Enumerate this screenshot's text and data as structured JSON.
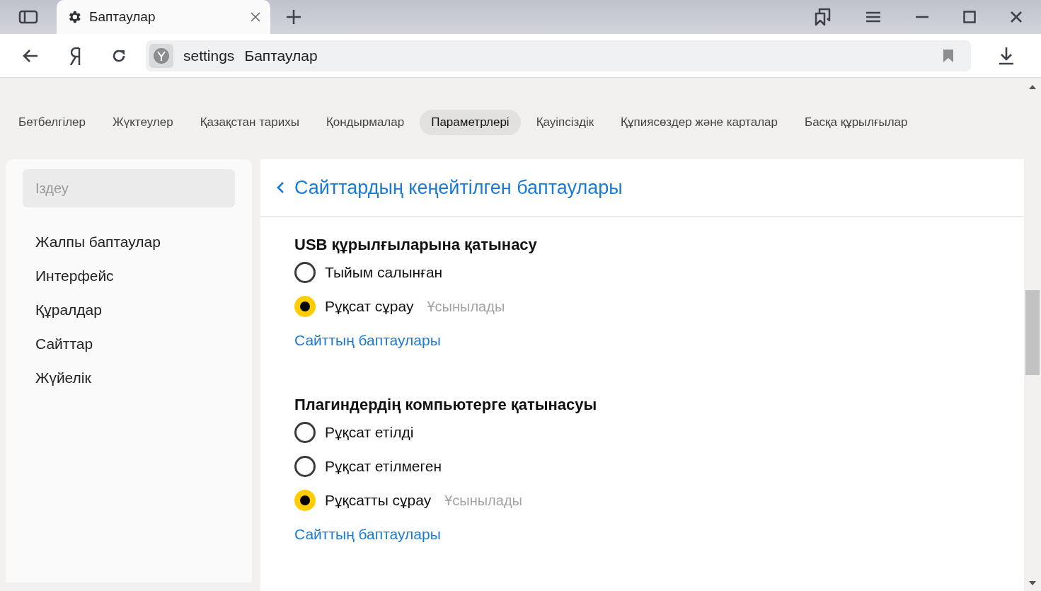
{
  "browser_tab": {
    "title": "Баптаулар"
  },
  "address_bar": {
    "host": "settings",
    "page": "Баптаулар"
  },
  "nav_tabs": [
    {
      "label": "Бетбелгілер",
      "selected": false
    },
    {
      "label": "Жүктеулер",
      "selected": false
    },
    {
      "label": "Қазақстан тарихы",
      "selected": false
    },
    {
      "label": "Қондырмалар",
      "selected": false
    },
    {
      "label": "Параметрлері",
      "selected": true
    },
    {
      "label": "Қауіпсіздік",
      "selected": false
    },
    {
      "label": "Құпиясөздер және карталар",
      "selected": false
    },
    {
      "label": "Басқа құрылғылар",
      "selected": false
    }
  ],
  "sidebar": {
    "search": {
      "placeholder": "Іздеу"
    },
    "items": [
      "Жалпы баптаулар",
      "Интерфейс",
      "Құралдар",
      "Сайттар",
      "Жүйелік"
    ]
  },
  "page": {
    "title": "Сайттардың кеңейтілген баптаулары",
    "sections": [
      {
        "heading": "USB құрылғыларына қатынасу",
        "options": [
          {
            "label": "Тыйым салынған",
            "selected": false
          },
          {
            "label": "Рұқсат сұрау",
            "hint": "Ұсынылады",
            "selected": true
          }
        ],
        "link": "Сайттың баптаулары"
      },
      {
        "heading": "Плагиндердің компьютерге қатынасуы",
        "options": [
          {
            "label": "Рұқсат етілді",
            "selected": false
          },
          {
            "label": "Рұқсат етілмеген",
            "selected": false
          },
          {
            "label": "Рұқсатты сұрау",
            "hint": "Ұсынылады",
            "selected": true
          }
        ],
        "link": "Сайттың баптаулары"
      }
    ]
  }
}
